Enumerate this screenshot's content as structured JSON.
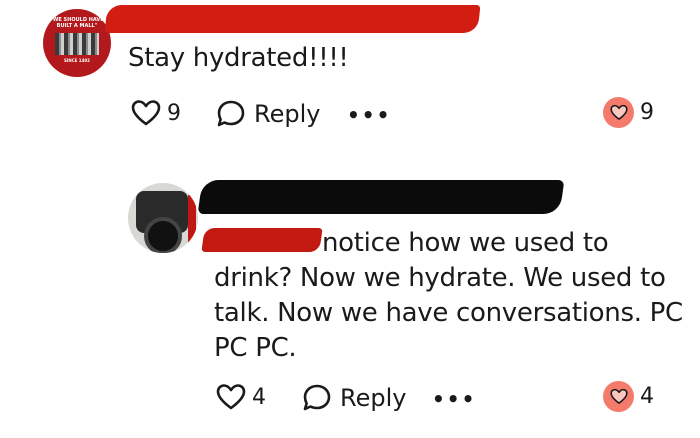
{
  "comments": [
    {
      "avatar": {
        "top_text": "\"WE SHOULD HAVE BUILT A MALL\"",
        "bottom_text": "SINCE 1492"
      },
      "text": "Stay hydrated!!!!",
      "likes": "9",
      "reply_label": "Reply",
      "more": "•••",
      "reactions": "9"
    },
    {
      "text_line1": "notice how we used to",
      "text_rest": "drink?  Now we hydrate.  We used to talk.  Now we have conversations. PC PC PC.",
      "likes": "4",
      "reply_label": "Reply",
      "more": "•••",
      "reactions": "4"
    }
  ],
  "colors": {
    "redaction_red": "#d11d12",
    "redaction_black": "#0b0b0b",
    "reaction_pink": "#f47b6c",
    "text": "#1a1a1a"
  },
  "icons": [
    "heart-outline-icon",
    "speech-bubble-icon",
    "heart-filled-icon",
    "more-dots-icon"
  ]
}
